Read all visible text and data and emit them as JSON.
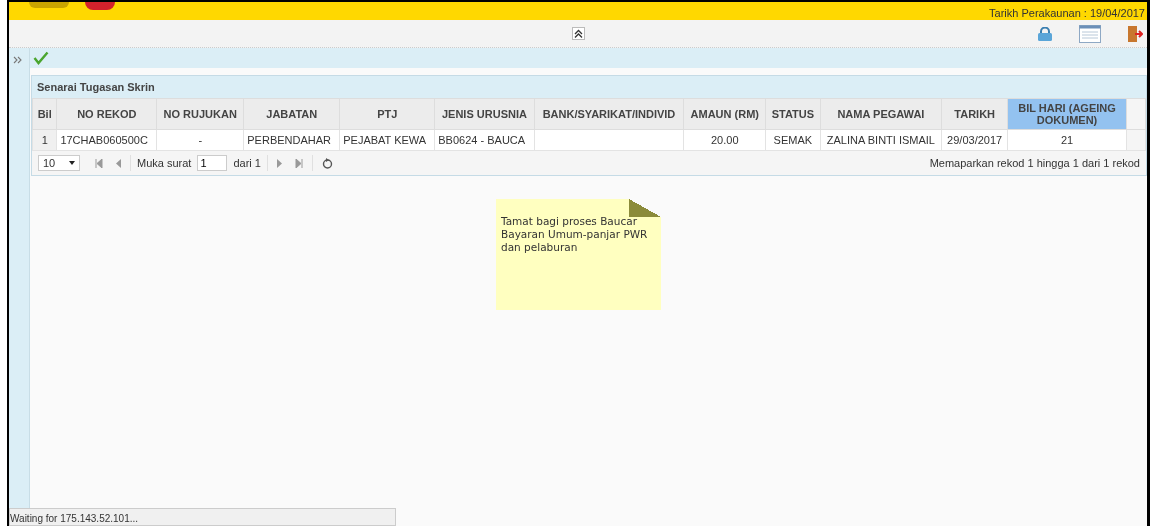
{
  "header": {
    "accounting_date": "Tarikh Perakaunan : 19/04/2017"
  },
  "panel": {
    "title": "Senarai Tugasan Skrin"
  },
  "table": {
    "columns": [
      {
        "label": "Bil",
        "highlighted": false
      },
      {
        "label": "NO REKOD",
        "highlighted": false
      },
      {
        "label": "NO RUJUKAN",
        "highlighted": false
      },
      {
        "label": "JABATAN",
        "highlighted": false
      },
      {
        "label": "PTJ",
        "highlighted": false
      },
      {
        "label": "JENIS URUSNIA",
        "highlighted": false
      },
      {
        "label": "BANK/SYARIKAT/INDIVID",
        "highlighted": false
      },
      {
        "label": "AMAUN (RM)",
        "highlighted": false
      },
      {
        "label": "STATUS",
        "highlighted": false
      },
      {
        "label": "NAMA PEGAWAI",
        "highlighted": false
      },
      {
        "label": "TARIKH",
        "highlighted": false
      },
      {
        "label": "BIL HARI (AGEING DOKUMEN)",
        "highlighted": true
      }
    ],
    "rows": [
      [
        "1",
        "17CHAB060500C",
        "-",
        "PERBENDAHAR",
        "PEJABAT KEWA",
        "BB0624 - BAUCA",
        "",
        "20.00",
        "SEMAK",
        "ZALINA BINTI ISMAIL",
        "29/03/2017",
        "21"
      ]
    ]
  },
  "pager": {
    "page_size": "10",
    "page_label": "Muka surat",
    "page": "1",
    "of_pages": "dari 1",
    "summary": "Memaparkan rekod 1 hingga 1 dari 1 rekod"
  },
  "note": {
    "text": "Tamat bagi proses Baucar Bayaran Umum-panjar PWR dan pelaburan"
  },
  "status_bar": "Waiting for 175.143.52.101..."
}
